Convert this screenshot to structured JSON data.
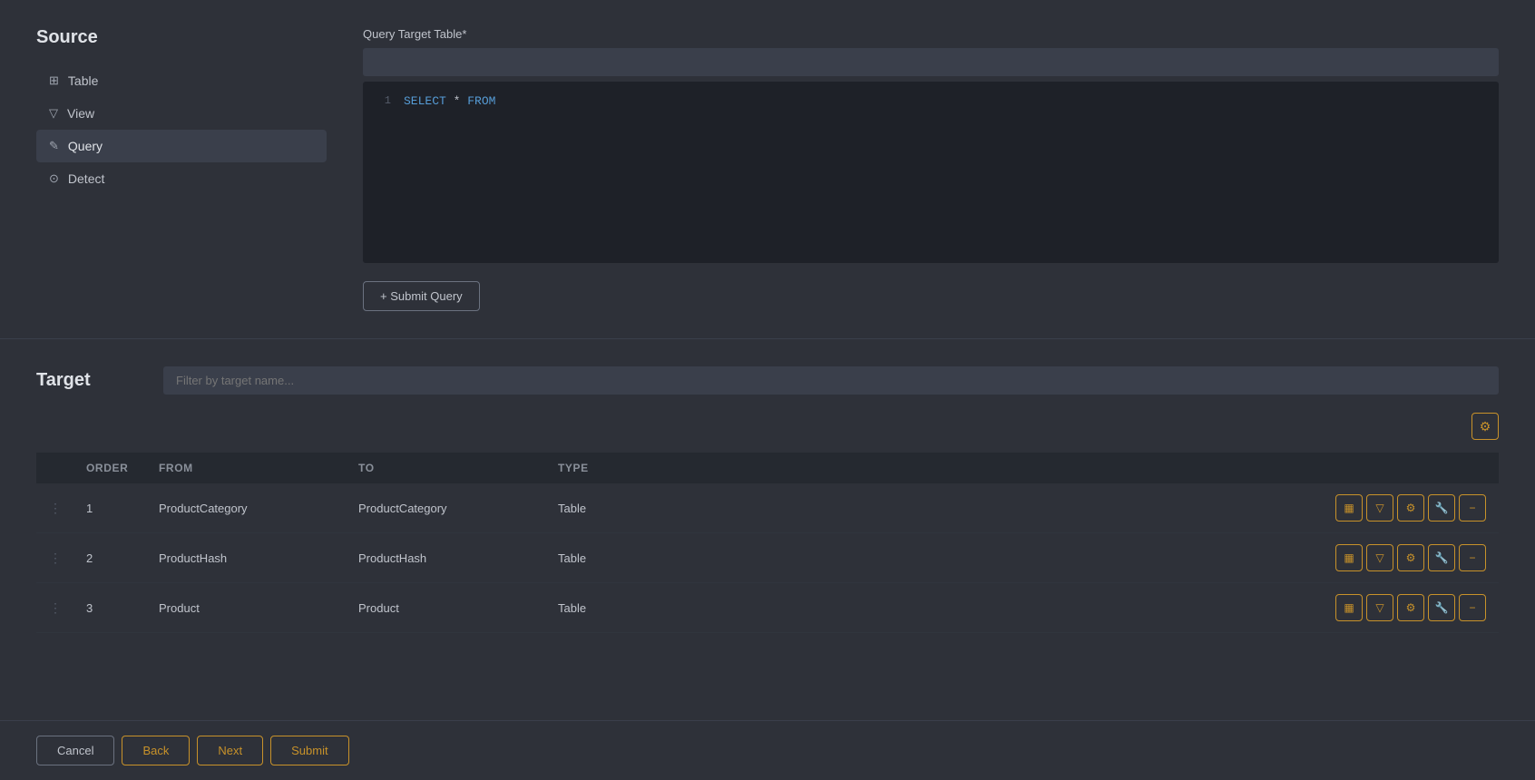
{
  "sidebar": {
    "title": "Source",
    "items": [
      {
        "id": "table",
        "label": "Table",
        "icon": "⊞",
        "active": false
      },
      {
        "id": "view",
        "label": "View",
        "icon": "▽",
        "active": false
      },
      {
        "id": "query",
        "label": "Query",
        "icon": "✎",
        "active": true
      },
      {
        "id": "detect",
        "label": "Detect",
        "icon": "⊙",
        "active": false
      }
    ]
  },
  "query_section": {
    "label": "Query Target Table*",
    "placeholder": "",
    "editor_line_number": "1",
    "editor_code": "SELECT * FROM",
    "submit_btn_label": "+ Submit Query"
  },
  "target_section": {
    "title": "Target",
    "filter_placeholder": "Filter by target name...",
    "table": {
      "columns": [
        "",
        "ORDER",
        "FROM",
        "TO",
        "TYPE",
        ""
      ],
      "rows": [
        {
          "drag": "⋮",
          "order": "1",
          "from": "ProductCategory",
          "to": "ProductCategory",
          "type": "Table"
        },
        {
          "drag": "⋮",
          "order": "2",
          "from": "ProductHash",
          "to": "ProductHash",
          "type": "Table"
        },
        {
          "drag": "⋮",
          "order": "3",
          "from": "Product",
          "to": "Product",
          "type": "Table"
        }
      ]
    },
    "add_btn_icon": "⚙"
  },
  "footer": {
    "cancel_label": "Cancel",
    "back_label": "Back",
    "next_label": "Next",
    "submit_label": "Submit"
  },
  "action_icons": {
    "columns_icon": "▦",
    "filter_icon": "▽",
    "settings_icon": "⚙",
    "wrench_icon": "🔧",
    "minus_icon": "−"
  }
}
